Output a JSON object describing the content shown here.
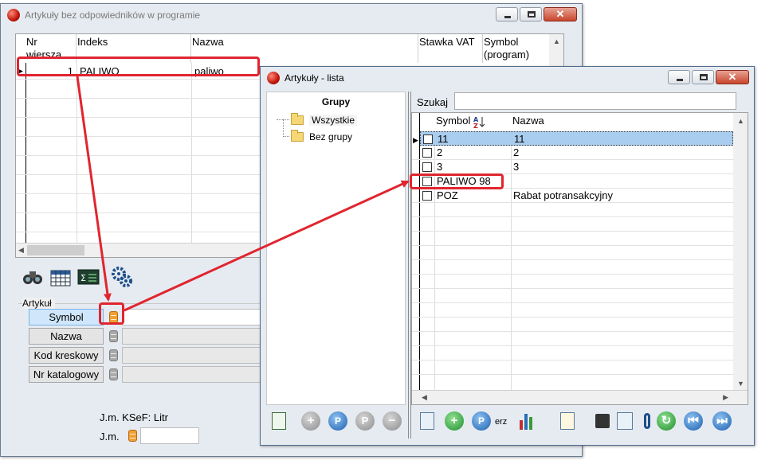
{
  "window1": {
    "title": "Artykuły bez odpowiedników w programie",
    "columns": [
      "Nr wiersza",
      "Indeks",
      "Nazwa",
      "Stawka VAT",
      "Symbol (program)"
    ],
    "rows": [
      {
        "nr": "1",
        "indeks": "PALIWO",
        "nazwa": "paliwo"
      }
    ],
    "tools": [
      "binoculars-icon",
      "table-icon",
      "formula-icon",
      "settings-icon"
    ],
    "group_label": "Artykuł",
    "fields": {
      "symbol": "Symbol",
      "nazwa": "Nazwa",
      "kod_kreskowy": "Kod kreskowy",
      "nr_katalogowy": "Nr katalogowy"
    },
    "jm_ksef": "J.m. KSeF: Litr",
    "jm_label": "J.m."
  },
  "window2": {
    "title": "Artykuły - lista",
    "groups_header": "Grupy",
    "groups": [
      "Wszystkie",
      "Bez grupy"
    ],
    "search_label": "Szukaj",
    "search_value": "",
    "columns": [
      "Symbol",
      "Nazwa"
    ],
    "sort_icon": "AZ",
    "rows": [
      {
        "symbol": "11",
        "nazwa": "11",
        "selected": true
      },
      {
        "symbol": "2",
        "nazwa": "2",
        "selected": false
      },
      {
        "symbol": "3",
        "nazwa": "3",
        "selected": false
      },
      {
        "symbol": "PALIWO 98",
        "nazwa": "",
        "selected": false
      },
      {
        "symbol": "POZ",
        "nazwa": "Rabat potransakcyjny",
        "selected": false
      }
    ],
    "toolbar_text": "erz"
  },
  "colors": {
    "annotation": "#e0252f",
    "selection": "#a9cdee",
    "active_field": "#cfe6fb"
  }
}
